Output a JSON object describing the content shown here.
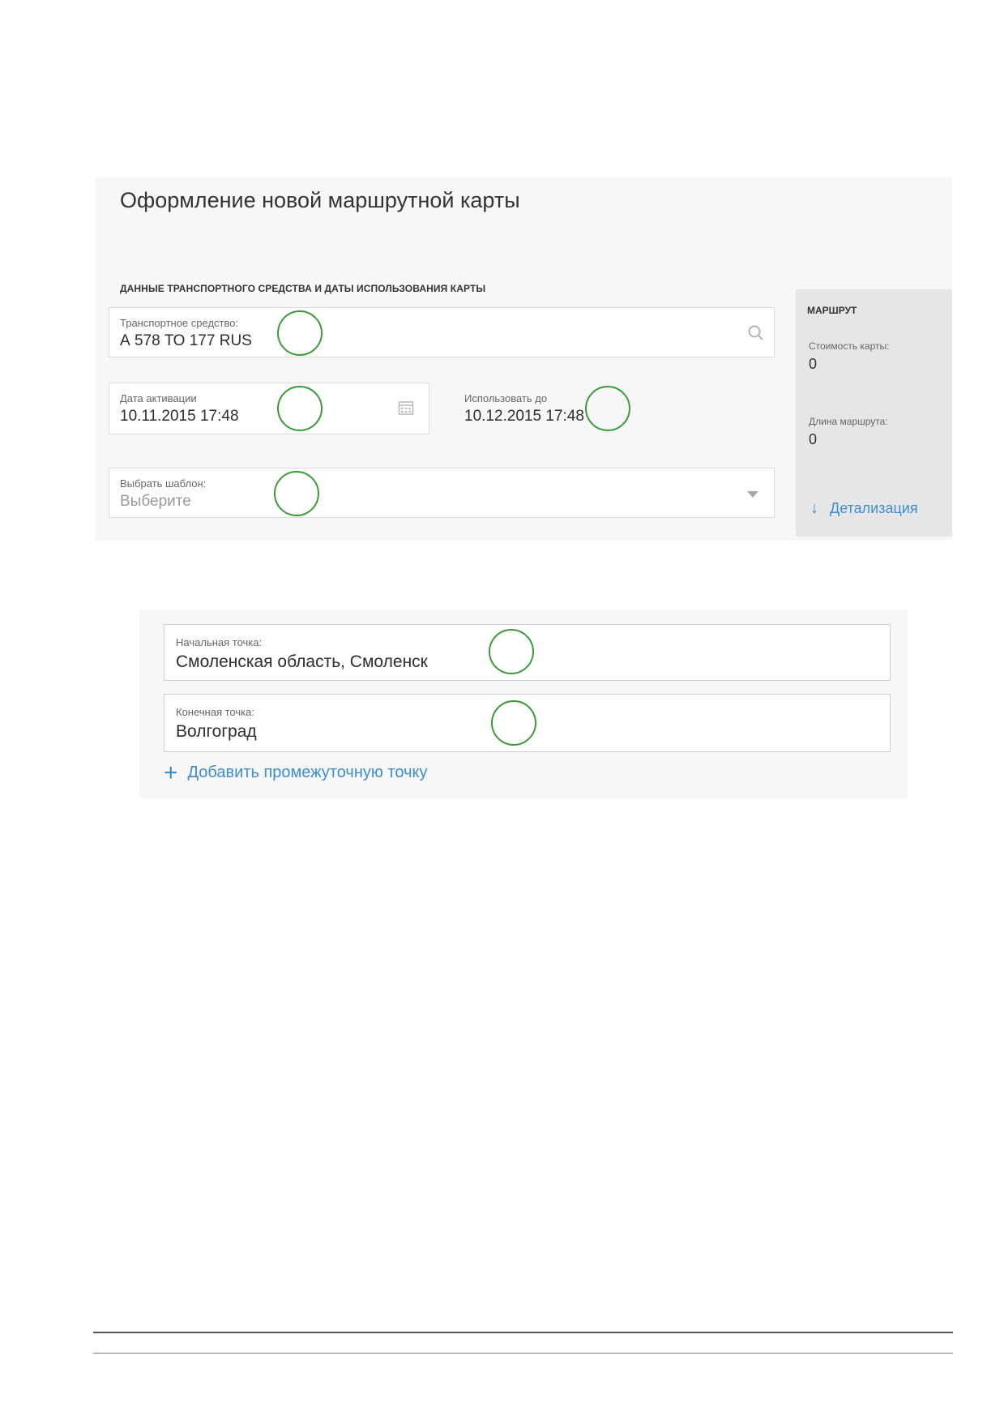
{
  "form": {
    "title": "Оформление новой маршрутной карты",
    "section_title": "ДАННЫЕ ТРАНСПОРТНОГО СРЕДСТВА И ДАТЫ ИСПОЛЬЗОВАНИЯ КАРТЫ",
    "vehicle": {
      "label": "Транспортное средство:",
      "value": "А 578 ТО 177 RUS",
      "icon": "search-icon"
    },
    "activation": {
      "label": "Дата активации",
      "value": "10.11.2015 17:48",
      "icon": "calendar-icon"
    },
    "use_until": {
      "label": "Использовать до",
      "value": "10.12.2015 17:48"
    },
    "template": {
      "label": "Выбрать шаблон:",
      "placeholder": "Выберите",
      "icon": "dropdown-caret-icon"
    }
  },
  "sidebar": {
    "title": "МАРШРУТ",
    "cost_label": "Стоимость карты:",
    "cost_value": "0",
    "length_label": "Длина маршрута:",
    "length_value": "0",
    "detail_link": "Детализация",
    "detail_icon": "arrow-down-icon"
  },
  "route": {
    "start": {
      "label": "Начальная точка:",
      "value": "Смоленская область, Смоленск"
    },
    "end": {
      "label": "Конечная точка:",
      "value": "Волгоград"
    },
    "add_point": "Добавить промежуточную точку",
    "add_icon": "plus-icon"
  },
  "colors": {
    "accent_link": "#3b8fd1",
    "annotation_circle": "#3c9a3a",
    "panel_bg": "#f7f7f7",
    "sidebar_bg": "#e6e6e6"
  }
}
